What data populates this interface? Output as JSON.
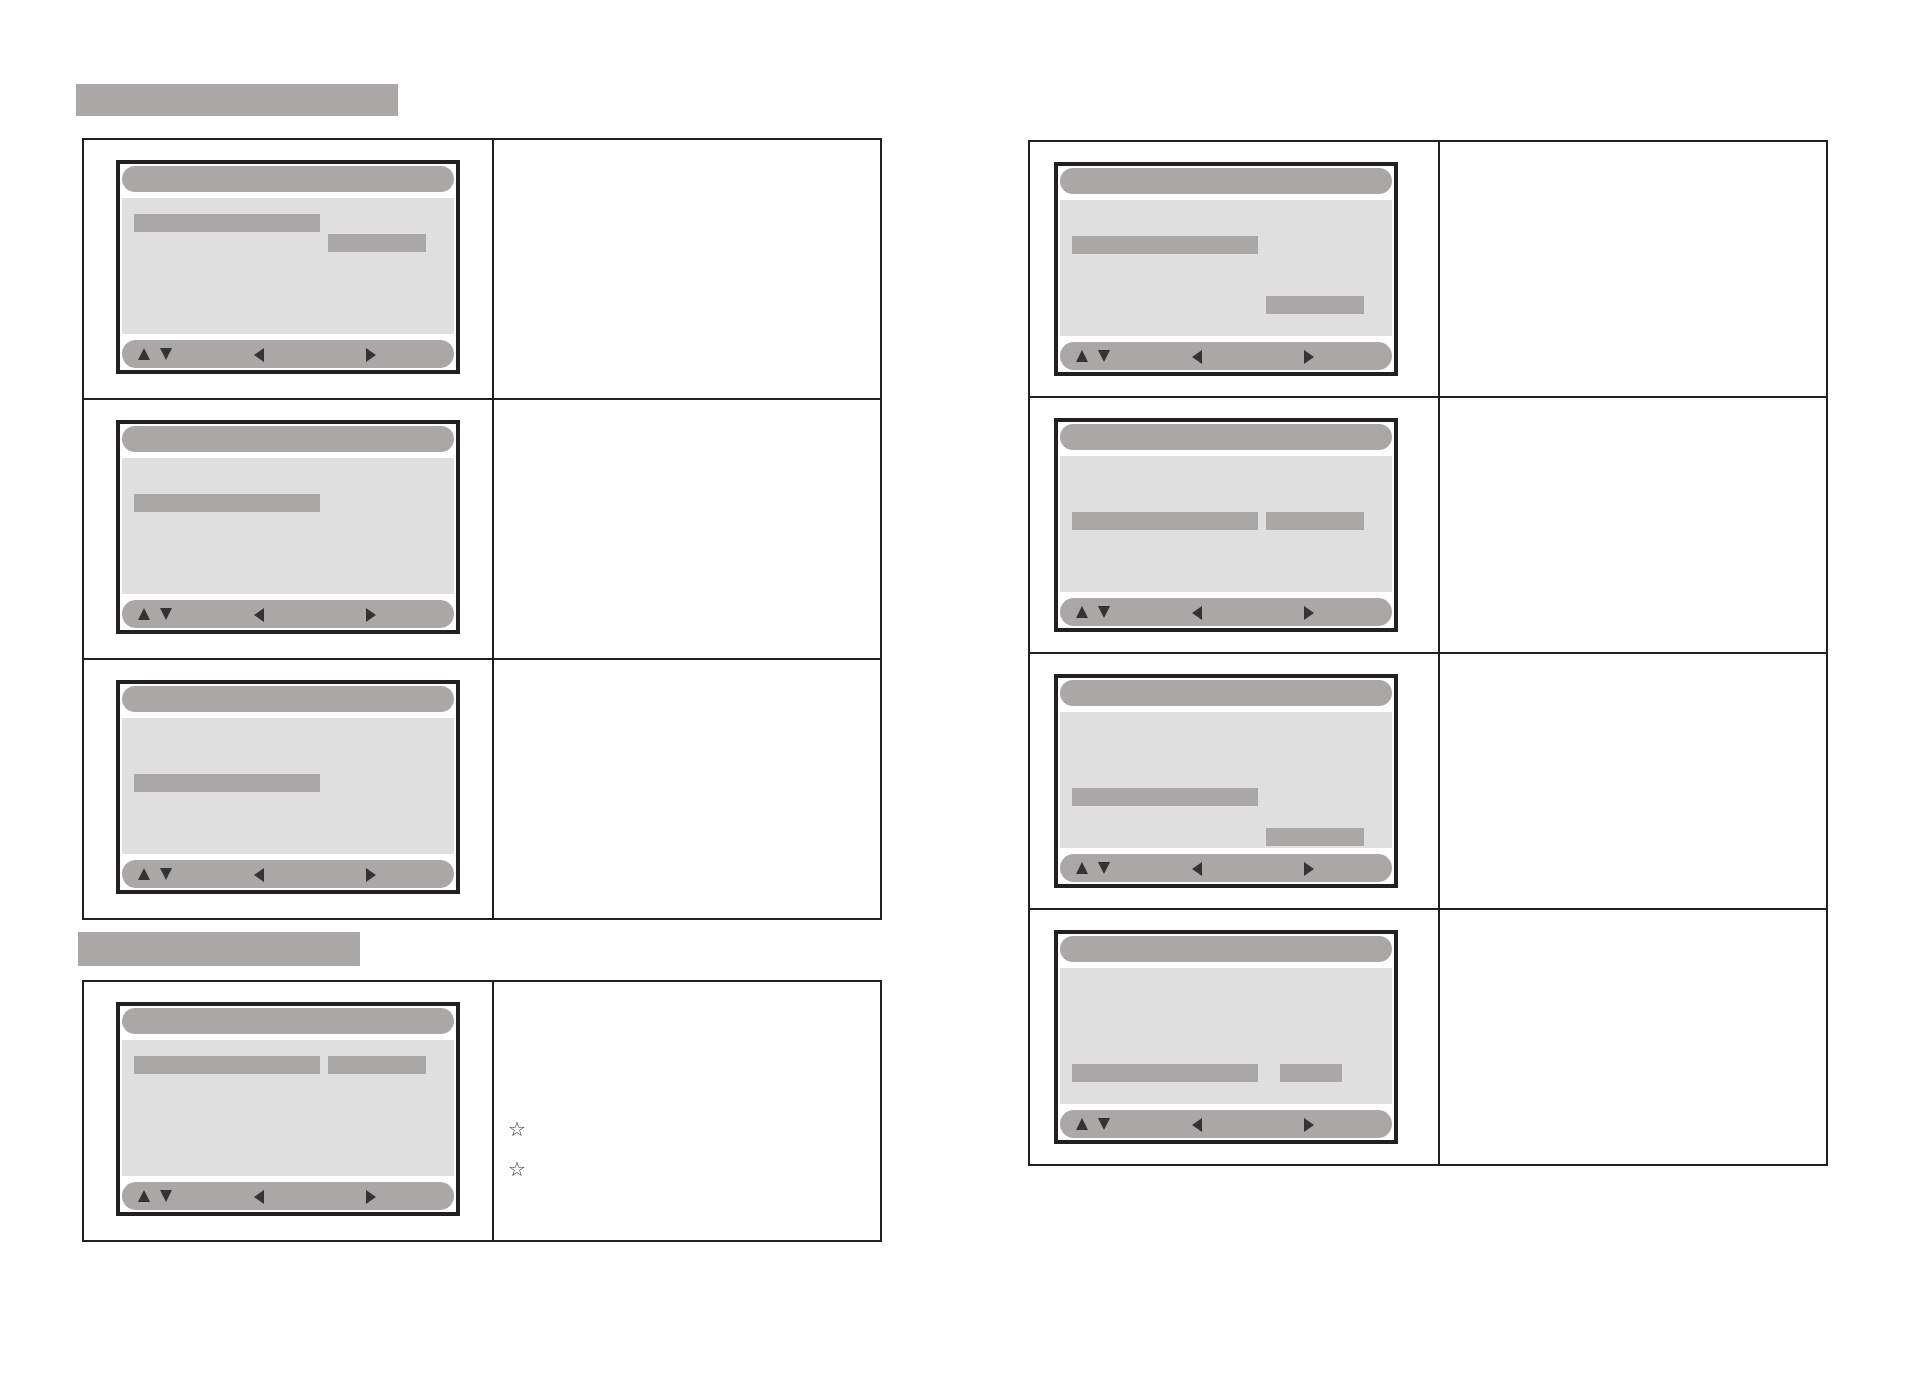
{
  "columns": [
    {
      "sections": [
        {
          "heading_bar": true,
          "entries": [
            {
              "menu_items": [
                {
                  "selected": true,
                  "value_selected": false
                },
                {
                  "selected": false,
                  "value_selected": true
                },
                {
                  "selected": false,
                  "value_selected": false
                },
                {
                  "selected": false,
                  "value_selected": false
                },
                {
                  "selected": false,
                  "value_selected": false
                },
                {
                  "selected": false,
                  "value_selected": false
                }
              ]
            },
            {
              "menu_items": [
                {
                  "selected": false,
                  "value_selected": false
                },
                {
                  "selected": true,
                  "value_selected": false
                },
                {
                  "selected": false,
                  "value_selected": false
                },
                {
                  "selected": false,
                  "value_selected": false
                },
                {
                  "selected": false,
                  "value_selected": false
                },
                {
                  "selected": false,
                  "value_selected": false
                }
              ]
            },
            {
              "menu_items": [
                {
                  "selected": false,
                  "value_selected": false
                },
                {
                  "selected": false,
                  "value_selected": false
                },
                {
                  "selected": true,
                  "value_selected": false
                },
                {
                  "selected": false,
                  "value_selected": false
                },
                {
                  "selected": false,
                  "value_selected": false
                },
                {
                  "selected": false,
                  "value_selected": false
                }
              ]
            }
          ]
        },
        {
          "heading_bar": true,
          "entries": [
            {
              "menu_items": [
                {
                  "selected": true,
                  "value_selected": true
                },
                {
                  "selected": false,
                  "value_selected": false
                },
                {
                  "selected": false,
                  "value_selected": false
                },
                {
                  "selected": false,
                  "value_selected": false
                },
                {
                  "selected": false,
                  "value_selected": false
                },
                {
                  "selected": false,
                  "value_selected": false
                }
              ],
              "notes": [
                "☆",
                "☆"
              ]
            }
          ]
        }
      ]
    },
    {
      "sections": [
        {
          "entries": [
            {
              "menu_items": [
                {
                  "selected": false,
                  "value_selected": false
                },
                {
                  "selected": true,
                  "value_selected": false
                },
                {
                  "selected": false,
                  "value_selected": false
                },
                {
                  "selected": false,
                  "value_selected": false
                },
                {
                  "selected": false,
                  "value_selected": true
                },
                {
                  "selected": false,
                  "value_selected": false
                }
              ]
            },
            {
              "menu_items": [
                {
                  "selected": false,
                  "value_selected": false
                },
                {
                  "selected": false,
                  "value_selected": false
                },
                {
                  "selected": true,
                  "value_selected": true
                },
                {
                  "selected": false,
                  "value_selected": false
                },
                {
                  "selected": false,
                  "value_selected": false
                },
                {
                  "selected": false,
                  "value_selected": false
                }
              ]
            },
            {
              "menu_items": [
                {
                  "selected": false,
                  "value_selected": false
                },
                {
                  "selected": false,
                  "value_selected": false
                },
                {
                  "selected": false,
                  "value_selected": false
                },
                {
                  "selected": true,
                  "value_selected": false
                },
                {
                  "selected": false,
                  "value_selected": false
                },
                {
                  "selected": false,
                  "value_selected": true
                }
              ]
            },
            {
              "menu_items": [
                {
                  "selected": false,
                  "value_selected": false
                },
                {
                  "selected": false,
                  "value_selected": false
                },
                {
                  "selected": false,
                  "value_selected": false
                },
                {
                  "selected": false,
                  "value_selected": false
                },
                {
                  "selected": true,
                  "value_selected": true
                },
                {
                  "selected": false,
                  "value_selected": false
                }
              ]
            }
          ]
        }
      ]
    }
  ]
}
